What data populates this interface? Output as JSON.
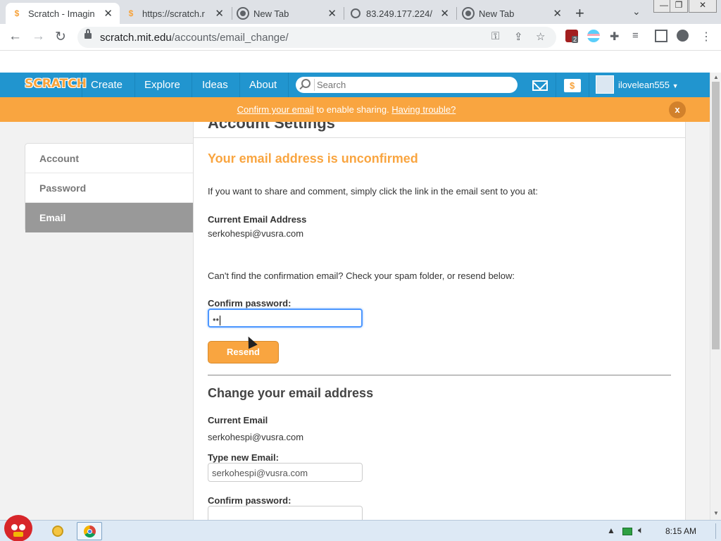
{
  "browser": {
    "tabs": [
      {
        "title": "Scratch - Imagin",
        "active": true,
        "favicon": "scratch-icon"
      },
      {
        "title": "https://scratch.r",
        "active": false,
        "favicon": "scratch-icon"
      },
      {
        "title": "New Tab",
        "active": false,
        "favicon": "chrome-icon"
      },
      {
        "title": "83.249.177.224/",
        "active": false,
        "favicon": "globe-icon"
      },
      {
        "title": "New Tab",
        "active": false,
        "favicon": "chrome-icon"
      }
    ],
    "url_host": "scratch.mit.edu",
    "url_path": "/accounts/email_change/",
    "extension_badge": "2"
  },
  "scratch_nav": {
    "logo": "SCRATCH",
    "links": [
      "Create",
      "Explore",
      "Ideas",
      "About"
    ],
    "search_placeholder": "Search",
    "username": "ilovelean555"
  },
  "banner": {
    "confirm_link": "Confirm your email",
    "middle_text": " to enable sharing. ",
    "trouble_link": "Having trouble?",
    "close": "x"
  },
  "sidebar": {
    "items": [
      {
        "label": "Account",
        "active": false
      },
      {
        "label": "Password",
        "active": false
      },
      {
        "label": "Email",
        "active": true
      }
    ]
  },
  "settings": {
    "page_title": "Account Settings",
    "unconfirmed_heading": "Your email address is unconfirmed",
    "intro": "If you want to share and comment, simply click the link in the email sent to you at:",
    "current_email_label": "Current Email Address",
    "current_email": "serkohespi@vusra.com",
    "spam_note": "Can't find the confirmation email? Check your spam folder, or resend below:",
    "confirm_password_label": "Confirm password:",
    "password_value": "••",
    "resend_button": "Resend",
    "change_heading": "Change your email address",
    "current_email_label_2": "Current Email",
    "current_email_2": "serkohespi@vusra.com",
    "new_email_label": "Type new Email:",
    "new_email_value": "serkohespi@vusra.com",
    "confirm_password_label_2": "Confirm password:"
  },
  "taskbar": {
    "clock": "8:15 AM"
  },
  "colors": {
    "scratch_blue": "#2195cf",
    "scratch_orange": "#f9a540"
  }
}
